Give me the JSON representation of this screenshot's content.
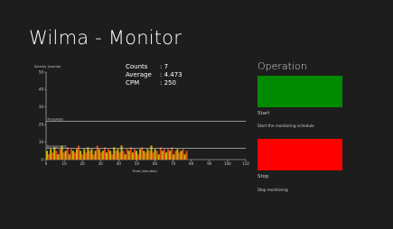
{
  "app": {
    "title": "Wilma - Monitor"
  },
  "stats": {
    "counts_label": "Counts",
    "counts_value": ": 7",
    "average_label": "Average",
    "average_value": ": 4.473",
    "cpm_label": "CPM",
    "cpm_value": ": 250"
  },
  "operation": {
    "title": "Operation",
    "start": {
      "label": "Start",
      "description": "Start the monitoring schedule",
      "color": "#008a00"
    },
    "stop": {
      "label": "Stop",
      "description": "Stop monitoring",
      "color": "#ff0000"
    }
  },
  "chart_data": {
    "type": "area",
    "title": "",
    "ylabel": "Activity (counts)",
    "xlabel": "Time (minutes)",
    "xlim": [
      0,
      110
    ],
    "ylim": [
      0,
      50
    ],
    "x_ticks": [
      0,
      10,
      20,
      30,
      40,
      50,
      60,
      70,
      80,
      90,
      100,
      110
    ],
    "y_ticks": [
      0,
      10,
      20,
      30,
      40,
      50
    ],
    "grid": false,
    "threshold": {
      "label": "Threshold",
      "value": 22
    },
    "background": {
      "label": "Background",
      "value": 6.5
    },
    "series": [
      {
        "values": [
          5,
          3,
          6,
          4,
          7,
          5,
          3,
          6,
          8,
          4,
          5,
          7,
          3,
          6,
          5,
          4,
          6,
          8,
          5,
          3,
          6,
          4,
          7,
          5,
          6,
          3,
          5,
          8,
          6,
          4,
          5,
          7,
          4,
          6,
          5,
          3,
          7,
          5,
          6,
          4,
          8,
          5,
          3,
          6,
          5,
          7,
          4,
          6,
          5,
          3,
          6,
          7,
          5,
          4,
          6,
          5,
          8,
          4,
          6,
          5,
          3,
          7,
          5,
          6,
          4,
          6,
          5,
          7,
          3,
          5,
          6,
          4,
          5,
          6,
          3,
          5
        ],
        "x_end": 78,
        "fill_colors": [
          "#d94a1a",
          "#c8b400"
        ]
      }
    ]
  }
}
